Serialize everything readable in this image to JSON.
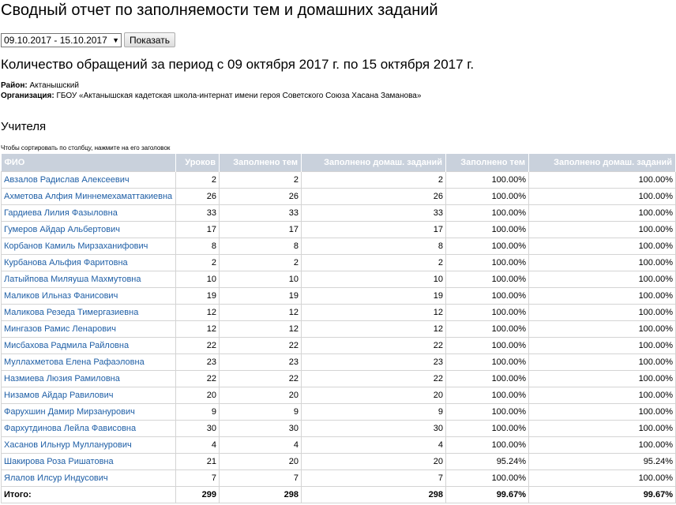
{
  "title": "Сводный отчет по заполняемости тем и домашних заданий",
  "period_select": {
    "value": "09.10.2017 - 15.10.2017"
  },
  "show_button": "Показать",
  "subtitle": "Количество обращений за период с 09 октября 2017 г. по 15 октября 2017 г.",
  "meta": {
    "district_label": "Район:",
    "district_value": "Актанышский",
    "org_label": "Организация:",
    "org_value": "ГБОУ «Актанышская кадетская школа-интернат имени героя Советского Союза Хасана Заманова»"
  },
  "section_title": "Учителя",
  "sort_hint": "Чтобы сортировать по столбцу, нажмите на его заголовок",
  "columns": [
    "ФИО",
    "Уроков",
    "Заполнено тем",
    "Заполнено домаш. заданий",
    "Заполнено тем",
    "Заполнено домаш. заданий"
  ],
  "rows": [
    [
      "Авзалов Радислав Алексеевич",
      "2",
      "2",
      "2",
      "100.00%",
      "100.00%"
    ],
    [
      "Ахметова Алфия Миннемехаматтакиевна",
      "26",
      "26",
      "26",
      "100.00%",
      "100.00%"
    ],
    [
      "Гардиева Лилия Фазыловна",
      "33",
      "33",
      "33",
      "100.00%",
      "100.00%"
    ],
    [
      "Гумеров Айдар Альбертович",
      "17",
      "17",
      "17",
      "100.00%",
      "100.00%"
    ],
    [
      "Корбанов Камиль Мирзаханифович",
      "8",
      "8",
      "8",
      "100.00%",
      "100.00%"
    ],
    [
      "Курбанова Альфия Фаритовна",
      "2",
      "2",
      "2",
      "100.00%",
      "100.00%"
    ],
    [
      "Латыйпова Миляуша Махмутовна",
      "10",
      "10",
      "10",
      "100.00%",
      "100.00%"
    ],
    [
      "Маликов Ильназ Фанисович",
      "19",
      "19",
      "19",
      "100.00%",
      "100.00%"
    ],
    [
      "Маликова Резеда Тимергазиевна",
      "12",
      "12",
      "12",
      "100.00%",
      "100.00%"
    ],
    [
      "Мингазов Рамис Ленарович",
      "12",
      "12",
      "12",
      "100.00%",
      "100.00%"
    ],
    [
      "Мисбахова Радмила Райловна",
      "22",
      "22",
      "22",
      "100.00%",
      "100.00%"
    ],
    [
      "Муллахметова Елена Рафаэловна",
      "23",
      "23",
      "23",
      "100.00%",
      "100.00%"
    ],
    [
      "Назмиева Люзия Рамиловна",
      "22",
      "22",
      "22",
      "100.00%",
      "100.00%"
    ],
    [
      "Низамов Айдар Равилович",
      "20",
      "20",
      "20",
      "100.00%",
      "100.00%"
    ],
    [
      "Фарухшин Дамир Мирзанурович",
      "9",
      "9",
      "9",
      "100.00%",
      "100.00%"
    ],
    [
      "Фархутдинова Лейла Фависовна",
      "30",
      "30",
      "30",
      "100.00%",
      "100.00%"
    ],
    [
      "Хасанов Ильнур Мулланурович",
      "4",
      "4",
      "4",
      "100.00%",
      "100.00%"
    ],
    [
      "Шакирова Роза Ришатовна",
      "21",
      "20",
      "20",
      "95.24%",
      "95.24%"
    ],
    [
      "Ялалов Илсур Индусович",
      "7",
      "7",
      "7",
      "100.00%",
      "100.00%"
    ]
  ],
  "totals": [
    "Итого:",
    "299",
    "298",
    "298",
    "99.67%",
    "99.67%"
  ],
  "colors": {
    "header_bg": "#c9d1dc",
    "link": "#1f5fa6"
  }
}
